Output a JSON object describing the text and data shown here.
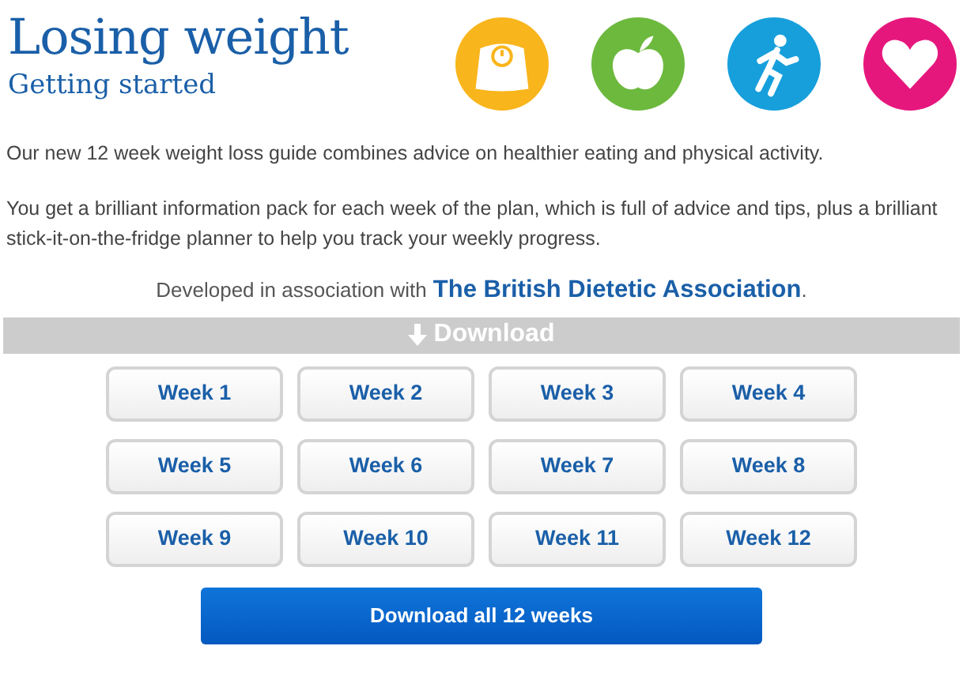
{
  "header": {
    "title": "Losing weight",
    "subtitle": "Getting started"
  },
  "icons": [
    {
      "kind": "scale",
      "color": "#f9b51c"
    },
    {
      "kind": "apple",
      "color": "#6cb93e"
    },
    {
      "kind": "runner",
      "color": "#179fdc"
    },
    {
      "kind": "heart",
      "color": "#e5177d"
    }
  ],
  "intro": [
    "Our new 12 week weight loss guide combines advice on healthier eating and physical activity.",
    "You get a brilliant information pack for each week of the plan, which is full of advice and tips, plus a brilliant stick-it-on-the-fridge planner to help you track your weekly progress."
  ],
  "partner": {
    "text": "Developed in association with",
    "link": "The British Dietetic Association",
    "after": "."
  },
  "download_bar": {
    "label": "Download"
  },
  "weeks": [
    "Week 1",
    "Week 2",
    "Week 3",
    "Week 4",
    "Week 5",
    "Week 6",
    "Week 7",
    "Week 8",
    "Week 9",
    "Week 10",
    "Week 11",
    "Week 12"
  ],
  "download_all": "Download all 12 weeks"
}
